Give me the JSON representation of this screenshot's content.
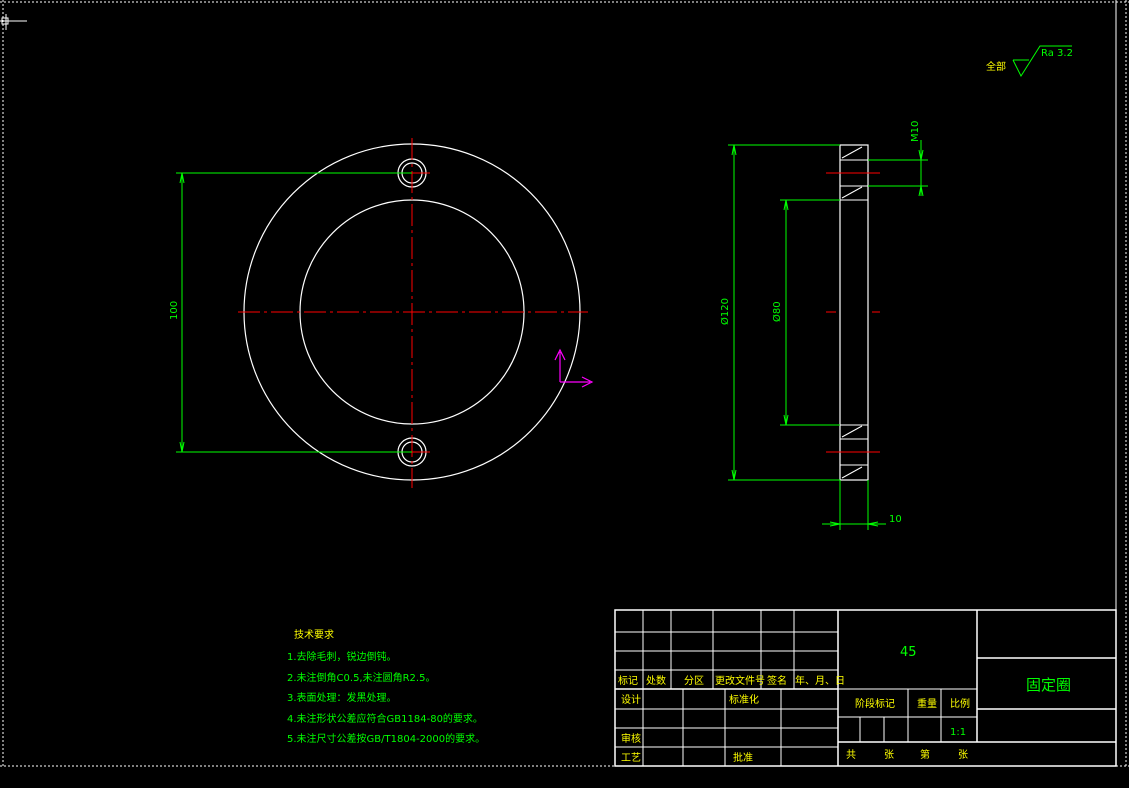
{
  "drawing": {
    "surface_finish": {
      "prefix": "全部",
      "value": "Ra 3.2"
    },
    "dimensions": {
      "hole_spacing": "100",
      "outer_diameter": "Ø120",
      "inner_diameter": "Ø80",
      "thread": "M10",
      "thickness": "10"
    }
  },
  "tech_requirements": {
    "title": "技术要求",
    "items": [
      "1.去除毛刺，锐边倒钝。",
      "2.未注倒角C0.5,未注圆角R2.5。",
      "3.表面处理：发黑处理。",
      "4.未注形状公差应符合GB1184-80的要求。",
      "5.未注尺寸公差按GB/T1804-2000的要求。"
    ]
  },
  "title_block": {
    "material": "45",
    "part_name": "固定圈",
    "labels": {
      "mark": "标记",
      "count": "处数",
      "zone": "分区",
      "change_doc": "更改文件号",
      "signature": "签名",
      "date": "年、月、日",
      "design": "设计",
      "standardize": "标准化",
      "stage_mark": "阶段标记",
      "weight": "重量",
      "scale": "比例",
      "scale_value": "1:1",
      "review": "审核",
      "process": "工艺",
      "approve": "批准",
      "total": "共",
      "sheets": "张",
      "page": "第",
      "sheet_end": "张"
    }
  },
  "colors": {
    "outline": "#ffffff",
    "dimension": "#00ff00",
    "centerline": "#ff0000",
    "ucs": "#ff00ff",
    "text_yellow": "#ffff00",
    "border_dashed": "#ffffff"
  }
}
